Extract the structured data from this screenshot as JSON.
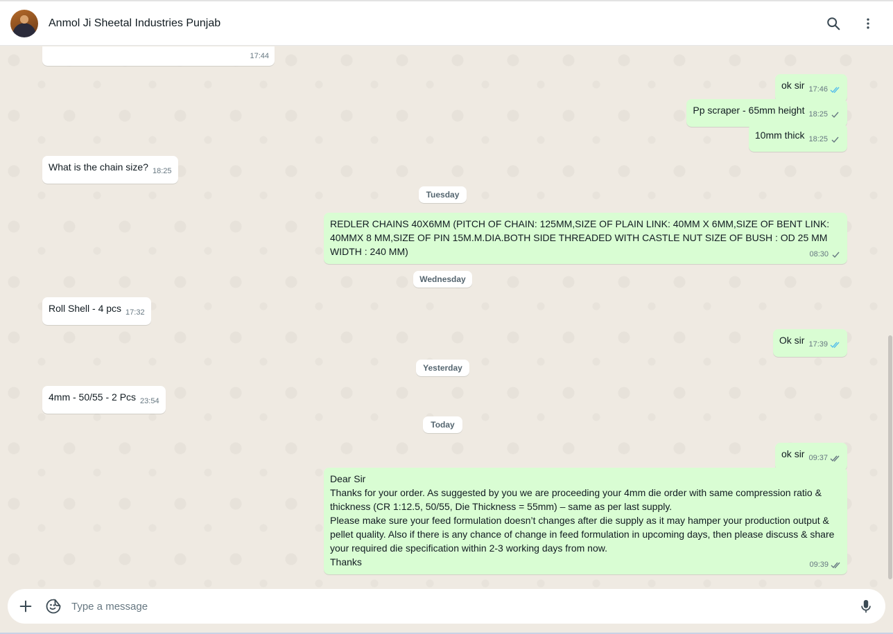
{
  "header": {
    "chat_name": "Anmol Ji Sheetal Industries Punjab"
  },
  "icons": {
    "search": "search-icon",
    "menu": "kebab-menu-icon",
    "attach": "plus-icon",
    "emoji": "sticker-icon",
    "mic": "microphone-icon",
    "read": "double-check-blue-icon",
    "delivered": "double-check-grey-icon",
    "sent": "single-check-icon"
  },
  "colors": {
    "incoming_bubble": "#ffffff",
    "outgoing_bubble": "#d9fdd3",
    "read_tick": "#53bdeb",
    "background": "#efeae2"
  },
  "messages": [
    {
      "text": "",
      "time": "17:44",
      "dir": "in"
    },
    {
      "text": "ok sir",
      "time": "17:46",
      "dir": "out",
      "status": "read"
    },
    {
      "text": "Pp scraper - 65mm height",
      "time": "18:25",
      "dir": "out",
      "status": "sent"
    },
    {
      "text": "10mm thick",
      "time": "18:25",
      "dir": "out",
      "status": "sent"
    },
    {
      "text": "What is the chain size?",
      "time": "18:25",
      "dir": "in"
    },
    {
      "text": "REDLER CHAINS 40X6MM (PITCH OF CHAIN: 125MM,SIZE OF PLAIN LINK: 40MM X 6MM,SIZE OF BENT LINK: 40MMX 8 MM,SIZE OF PIN 15M.M.DIA.BOTH SIDE THREADED WITH CASTLE NUT SIZE OF BUSH : OD 25 MM WIDTH : 240 MM)",
      "time": "08:30",
      "dir": "out",
      "status": "sent"
    },
    {
      "text": "Roll Shell - 4 pcs",
      "time": "17:32",
      "dir": "in"
    },
    {
      "text": "Ok sir",
      "time": "17:39",
      "dir": "out",
      "status": "read"
    },
    {
      "text": "4mm - 50/55 - 2 Pcs",
      "time": "23:54",
      "dir": "in"
    },
    {
      "text": "ok sir",
      "time": "09:37",
      "dir": "out",
      "status": "delivered"
    },
    {
      "text": "Dear Sir\nThanks for your order. As suggested by you we are proceeding your 4mm die order with same compression ratio & thickness (CR 1:12.5, 50/55, Die Thickness = 55mm) – same as per last supply.\nPlease make sure your feed formulation doesn’t changes after die supply as it may hamper your production output & pellet quality. Also if there is any chance of change in feed formulation in upcoming days, then please discuss & share your required die specification within 2-3 working days from now.\nThanks",
      "time": "09:39",
      "dir": "out",
      "status": "delivered"
    }
  ],
  "date_separators": [
    "Tuesday",
    "Wednesday",
    "Yesterday",
    "Today"
  ],
  "composer": {
    "placeholder": "Type a message"
  }
}
